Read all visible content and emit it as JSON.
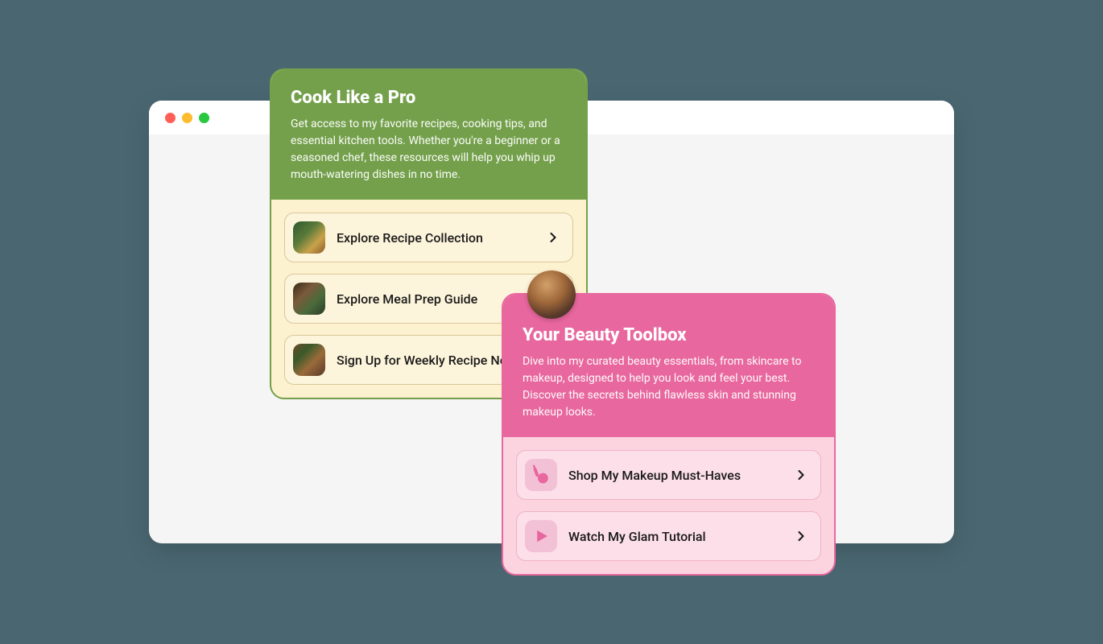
{
  "cards": {
    "cook": {
      "title": "Cook Like a Pro",
      "description": "Get access to my favorite recipes, cooking tips, and essential kitchen tools. Whether you're a beginner or a seasoned chef, these resources will help you whip up mouth-watering dishes in no time.",
      "links": [
        {
          "label": "Explore Recipe Collection"
        },
        {
          "label": "Explore Meal Prep Guide"
        },
        {
          "label": "Sign Up for Weekly Recipe Newsletter"
        }
      ]
    },
    "beauty": {
      "title": "Your Beauty Toolbox",
      "description": "Dive into my curated beauty essentials, from skincare to makeup, designed to help you look and feel your best. Discover the secrets behind flawless skin and stunning makeup looks.",
      "links": [
        {
          "label": "Shop My Makeup Must-Haves"
        },
        {
          "label": "Watch My Glam Tutorial"
        }
      ]
    }
  }
}
